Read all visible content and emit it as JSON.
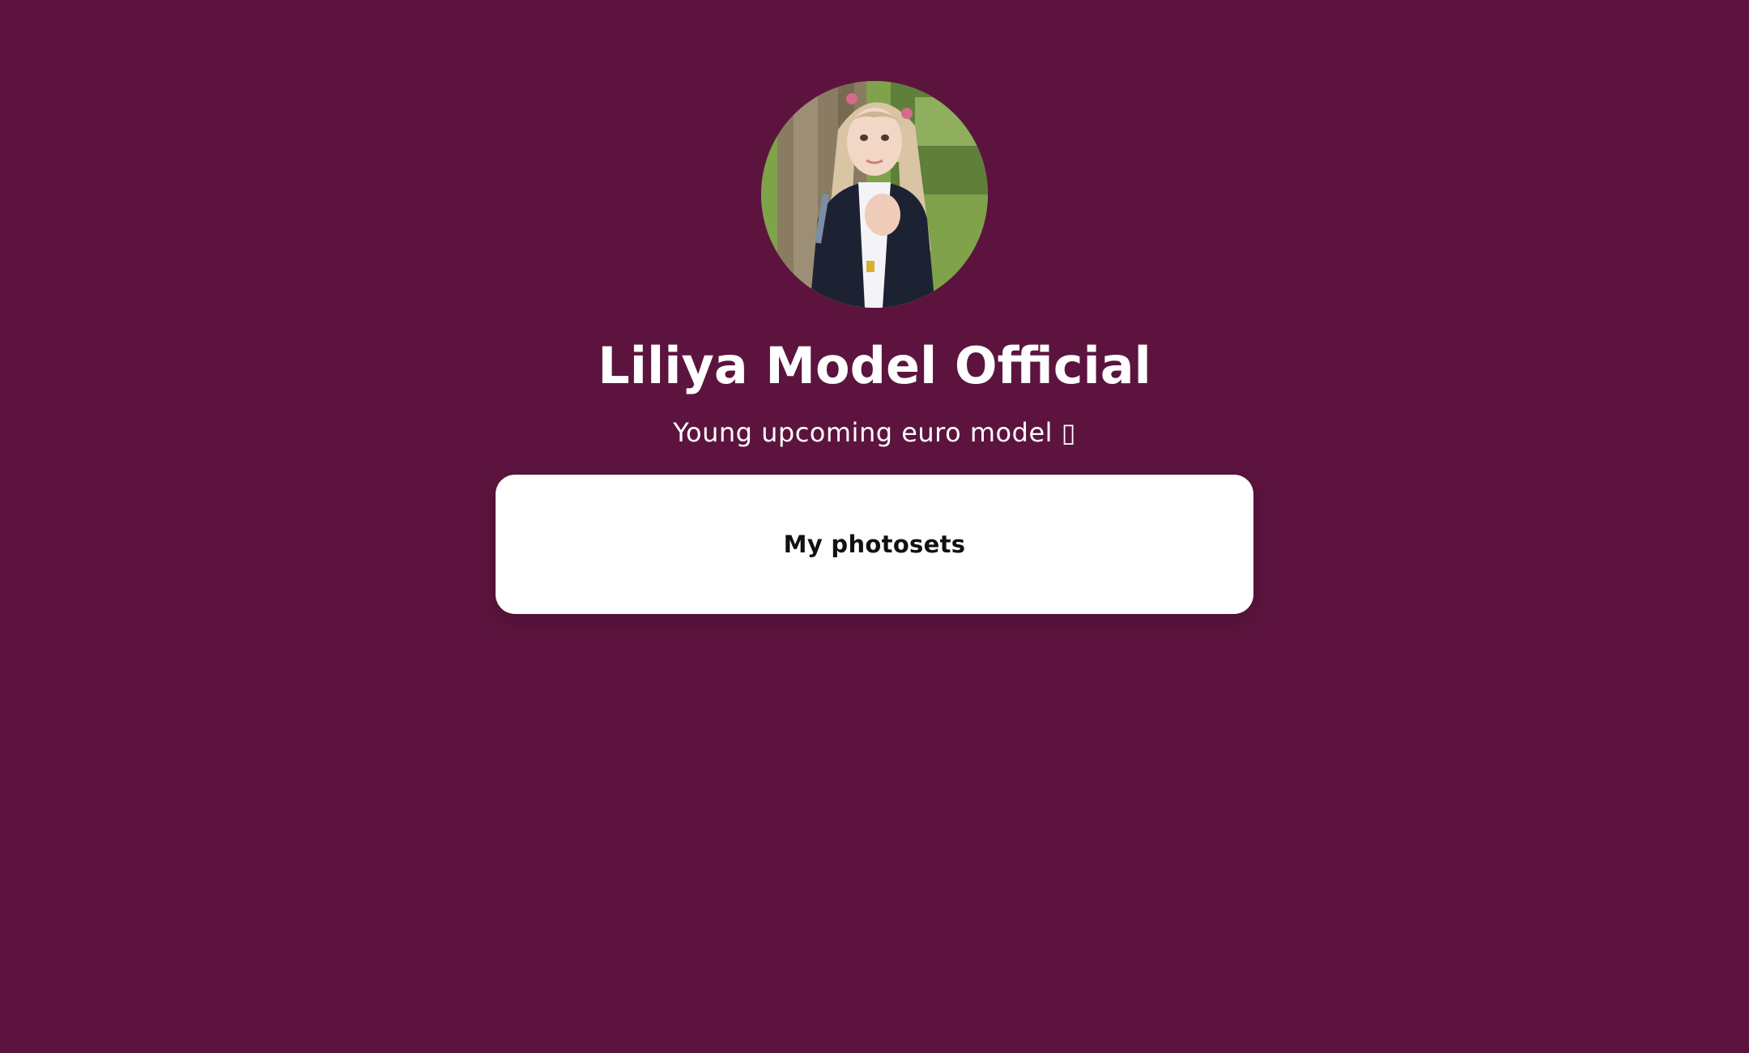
{
  "profile": {
    "name": "Liliya Model Official",
    "bio": "Young upcoming euro model ▯",
    "avatar_icon": "profile-photo"
  },
  "links": [
    {
      "label": "My photosets"
    }
  ],
  "colors": {
    "background": "#5c143e",
    "card": "#ffffff",
    "text_light": "#ffffff",
    "text_dark": "#111111"
  }
}
